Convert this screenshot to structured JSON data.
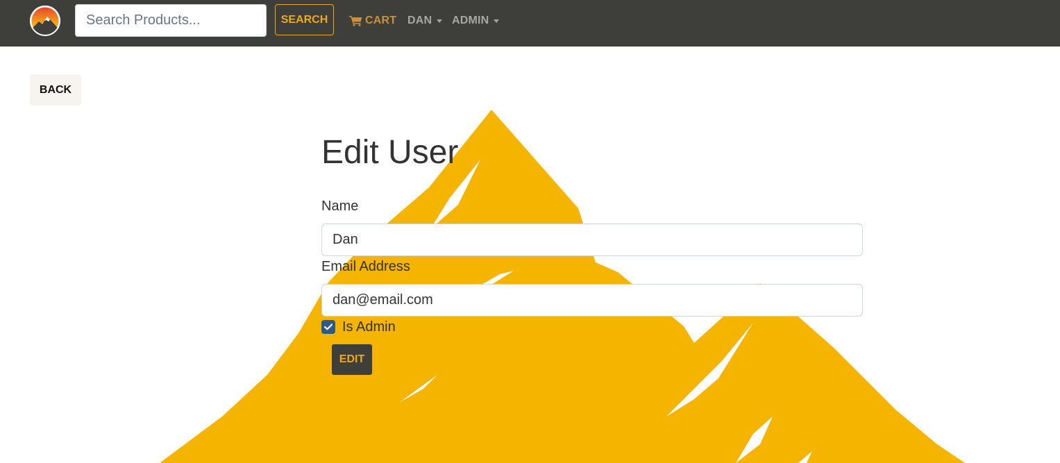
{
  "navbar": {
    "search_placeholder": "Search Products...",
    "search_label": "SEARCH",
    "cart_label": "CART",
    "user_menu_label": "DAN",
    "admin_menu_label": "ADMIN"
  },
  "back_label": "BACK",
  "form": {
    "title": "Edit User",
    "name_label": "Name",
    "name_value": "Dan",
    "email_label": "Email Address",
    "email_value": "dan@email.com",
    "is_admin_label": "Is Admin",
    "is_admin_checked": true,
    "submit_label": "EDIT"
  },
  "colors": {
    "navbar_bg": "#3e3e3a",
    "accent": "#f0a81c",
    "checkbox": "#2c5a8a",
    "mountain": "#f5b400"
  }
}
